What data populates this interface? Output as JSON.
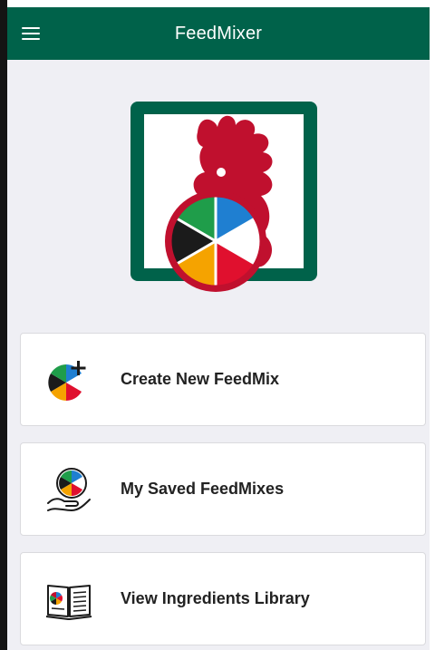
{
  "app": {
    "title": "FeedMixer"
  },
  "menu": {
    "items": [
      {
        "label": "Create New FeedMix",
        "icon": "create-feedmix-icon"
      },
      {
        "label": "My Saved FeedMixes",
        "icon": "saved-feedmixes-icon"
      },
      {
        "label": "View Ingredients Library",
        "icon": "ingredients-library-icon"
      }
    ]
  },
  "colors": {
    "brand_green": "#00624a",
    "rooster_red": "#c0102e",
    "background": "#efeff4",
    "card": "#ffffff"
  }
}
